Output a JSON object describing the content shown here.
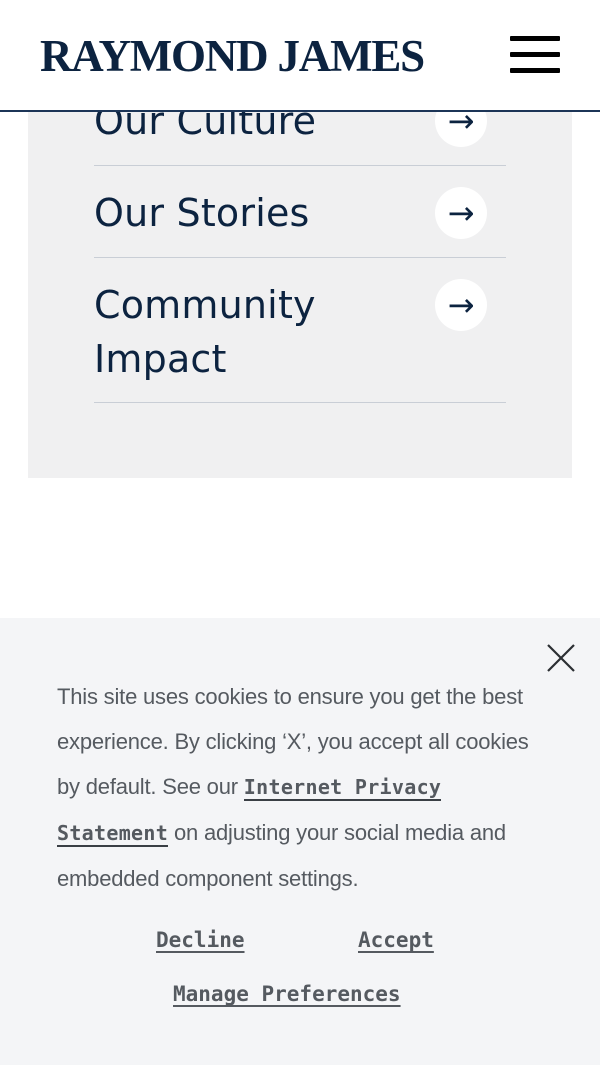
{
  "header": {
    "logo_text": "RAYMOND JAMES",
    "menu_icon": "hamburger-menu-icon"
  },
  "nav": {
    "items": [
      {
        "label": "Our Culture",
        "icon": "arrow-right-icon"
      },
      {
        "label": "Our Stories",
        "icon": "arrow-right-icon"
      },
      {
        "label": "Community Impact",
        "icon": "arrow-right-icon"
      }
    ]
  },
  "cookie_banner": {
    "text_before": "This site uses cookies to ensure you get the best experience. By clicking ‘X’, you accept all cookies by default. See our ",
    "privacy_link": "Internet Privacy Statement",
    "text_after": " on adjusting your social media and embedded component settings.",
    "decline_label": "Decline",
    "accept_label": "Accept",
    "manage_label": "Manage Preferences",
    "close_icon": "close-icon"
  },
  "colors": {
    "brand_navy": "#0c2340",
    "panel_bg": "#f0f0f1",
    "banner_bg": "#f4f5f7",
    "banner_text": "#555a60"
  }
}
